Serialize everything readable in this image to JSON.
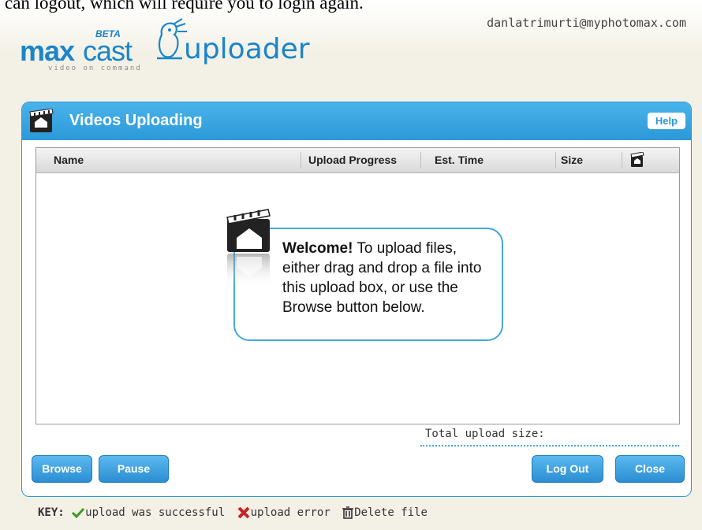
{
  "top_text": "can logout, which will require you to login again.",
  "header": {
    "brand_max": "max",
    "brand_cast": "cast",
    "brand_beta": "BETA",
    "brand_tagline": "video on command",
    "brand_uploader": "uploader",
    "user_email": "danlatrimurti@myphotomax.com"
  },
  "panel": {
    "title": "Videos Uploading",
    "help_label": "Help",
    "columns": {
      "name": "Name",
      "progress": "Upload Progress",
      "est_time": "Est. Time",
      "size": "Size"
    },
    "welcome": {
      "heading": "Welcome!",
      "message": "To upload files, either drag and drop a file into this upload box, or use the Browse button below."
    },
    "total_label": "Total upload size:",
    "buttons": {
      "browse": "Browse",
      "pause": "Pause",
      "logout": "Log Out",
      "close": "Close"
    }
  },
  "key": {
    "label": "KEY:",
    "success": "upload was successful",
    "error": "upload error",
    "delete": "Delete file"
  },
  "colors": {
    "accent": "#2b98d8",
    "brand": "#1b85c9",
    "background": "#f3f1e6"
  }
}
